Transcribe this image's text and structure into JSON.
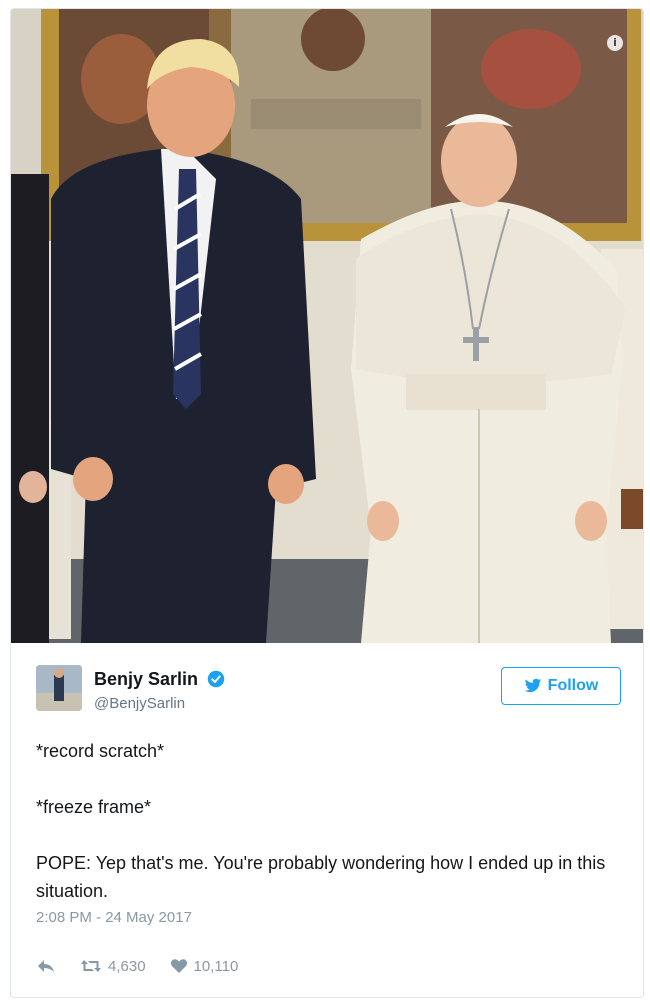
{
  "tweet": {
    "author_name": "Benjy Sarlin",
    "author_handle": "@BenjySarlin",
    "follow_label": "Follow",
    "lines": [
      "*record scratch*",
      "*freeze frame*",
      "POPE: Yep that's me. You're probably wondering how I ended up in this situation."
    ],
    "timestamp": "2:08 PM - 24 May 2017",
    "retweets": "4,630",
    "likes": "10,110"
  },
  "icons": {
    "media_info": "info-icon",
    "verified": "verified-badge-icon",
    "follow": "bird-icon",
    "reply": "reply-icon",
    "retweet": "retweet-icon",
    "like": "heart-icon"
  },
  "colors": {
    "accent": "#1da1f2",
    "text": "#14171a",
    "muted": "#657786",
    "timestamp": "#8899a6"
  }
}
